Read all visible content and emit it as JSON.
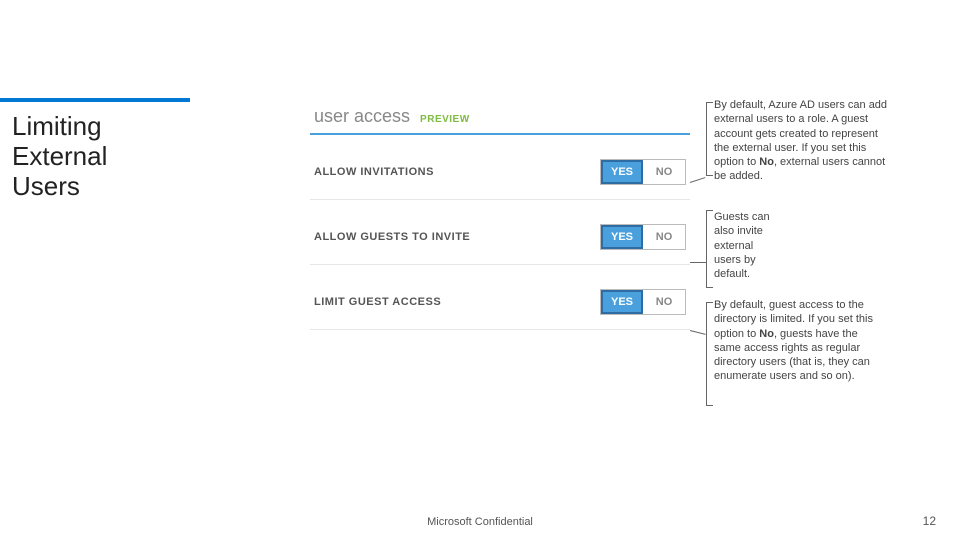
{
  "title": "Limiting External Users",
  "panel": {
    "header": "user access",
    "tag": "PREVIEW",
    "settings": [
      {
        "label": "ALLOW INVITATIONS",
        "yes": "YES",
        "no": "NO"
      },
      {
        "label": "ALLOW GUESTS TO INVITE",
        "yes": "YES",
        "no": "NO"
      },
      {
        "label": "LIMIT GUEST ACCESS",
        "yes": "YES",
        "no": "NO"
      }
    ]
  },
  "callouts": {
    "c1a": "By default, Azure AD users can add external users to a role. A guest account gets created to represent the external user. If you set this option to ",
    "c1b": "No",
    "c1c": ", external users cannot be added.",
    "c2": "Guests can also invite external users by default.",
    "c3a": "By default, guest access to the directory is limited. If you set this option to ",
    "c3b": "No",
    "c3c": ", guests have the same access rights as regular directory users (that is, they can enumerate users and so on)."
  },
  "footer": {
    "confidential": "Microsoft Confidential",
    "page": "12"
  }
}
